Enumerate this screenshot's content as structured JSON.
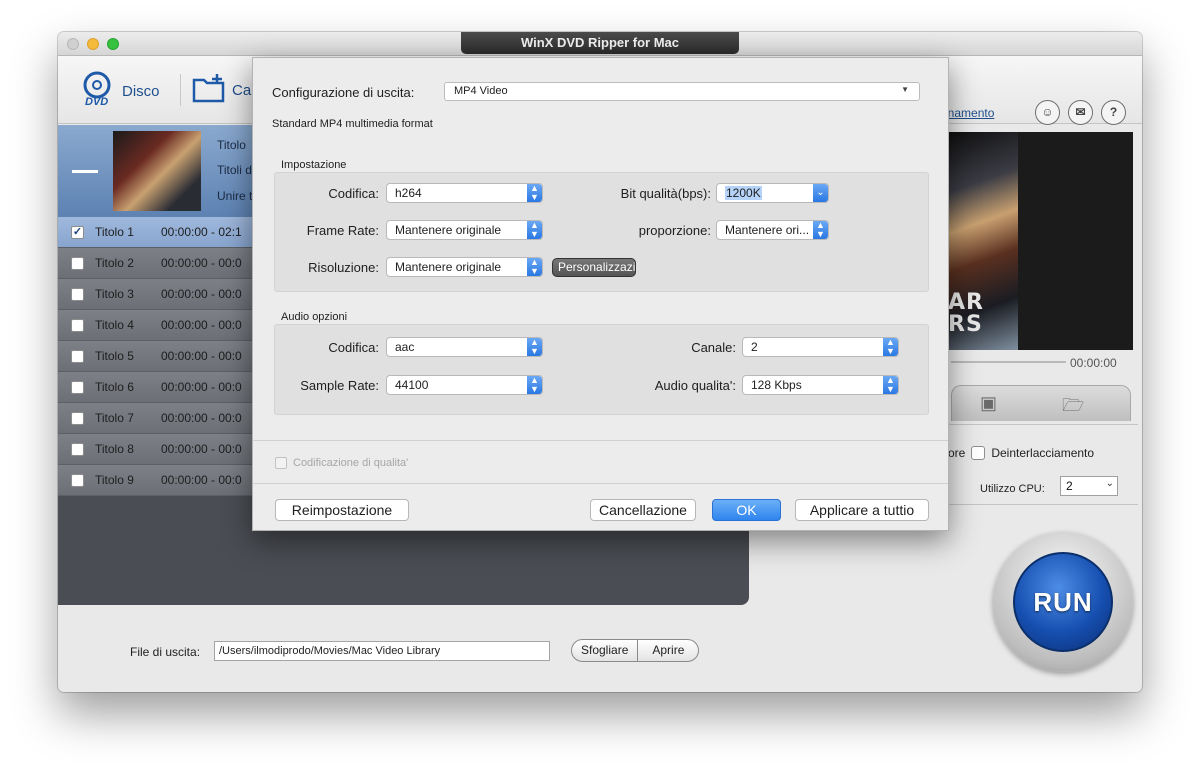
{
  "window": {
    "title": "WinX DVD Ripper for Mac"
  },
  "toolbar": {
    "disc_label": "Disco",
    "cartella_label": "Ca",
    "update_link": "ornamento"
  },
  "title_header": {
    "line1": "Titolo",
    "line2": "Titoli d",
    "line3": "Unire t"
  },
  "titles": [
    {
      "name": "Titolo 1",
      "time": "00:00:00 - 02:1",
      "checked": true
    },
    {
      "name": "Titolo 2",
      "time": "00:00:00 - 00:0",
      "checked": false
    },
    {
      "name": "Titolo 3",
      "time": "00:00:00 - 00:0",
      "checked": false
    },
    {
      "name": "Titolo 4",
      "time": "00:00:00 - 00:0",
      "checked": false
    },
    {
      "name": "Titolo 5",
      "time": "00:00:00 - 00:0",
      "checked": false
    },
    {
      "name": "Titolo 6",
      "time": "00:00:00 - 00:0",
      "checked": false
    },
    {
      "name": "Titolo 7",
      "time": "00:00:00 - 00:0",
      "checked": false
    },
    {
      "name": "Titolo 8",
      "time": "00:00:00 - 00:0",
      "checked": false
    },
    {
      "name": "Titolo 9",
      "time": "00:00:00 - 00:0",
      "checked": false
    }
  ],
  "preview": {
    "poster_text": "AR\nRS",
    "time": "00:00:00"
  },
  "options": {
    "partial_label": "ore",
    "deinterlace_label": "Deinterlacciamento",
    "cpu_label": "Utilizzo CPU:",
    "cpu_value": "2"
  },
  "run_label": "RUN",
  "output": {
    "label": "File di uscita:",
    "path": "/Users/ilmodiprodo/Movies/Mac Video Library",
    "browse_label": "Sfogliare",
    "open_label": "Aprire"
  },
  "dialog": {
    "config_label": "Configurazione di uscita:",
    "config_value": "MP4 Video",
    "description": "Standard MP4 multimedia format",
    "video_group_title": "Impostazione",
    "video": {
      "codec_label": "Codifica:",
      "codec_value": "h264",
      "bitrate_label": "Bit qualità(bps):",
      "bitrate_value": "1200K",
      "framerate_label": "Frame Rate:",
      "framerate_value": "Mantenere originale",
      "aspect_label": "proporzione:",
      "aspect_value": "Mantenere ori...",
      "resolution_label": "Risoluzione:",
      "resolution_value": "Mantenere originale",
      "custom_button": "Personalizzazi"
    },
    "audio_group_title": "Audio opzioni",
    "audio": {
      "codec_label": "Codifica:",
      "codec_value": "aac",
      "channel_label": "Canale:",
      "channel_value": "2",
      "samplerate_label": "Sample Rate:",
      "samplerate_value": "44100",
      "quality_label": "Audio qualita':",
      "quality_value": "128 Kbps"
    },
    "quality_encoding_label": "Codificazione di qualita'",
    "buttons": {
      "reset": "Reimpostazione",
      "cancel": "Cancellazione",
      "ok": "OK",
      "apply_all": "Applicare a tuttio"
    }
  },
  "colors": {
    "accent_blue": "#2f84ee",
    "run_blue": "#164fb0",
    "panel_dark": "#4a4d53"
  }
}
